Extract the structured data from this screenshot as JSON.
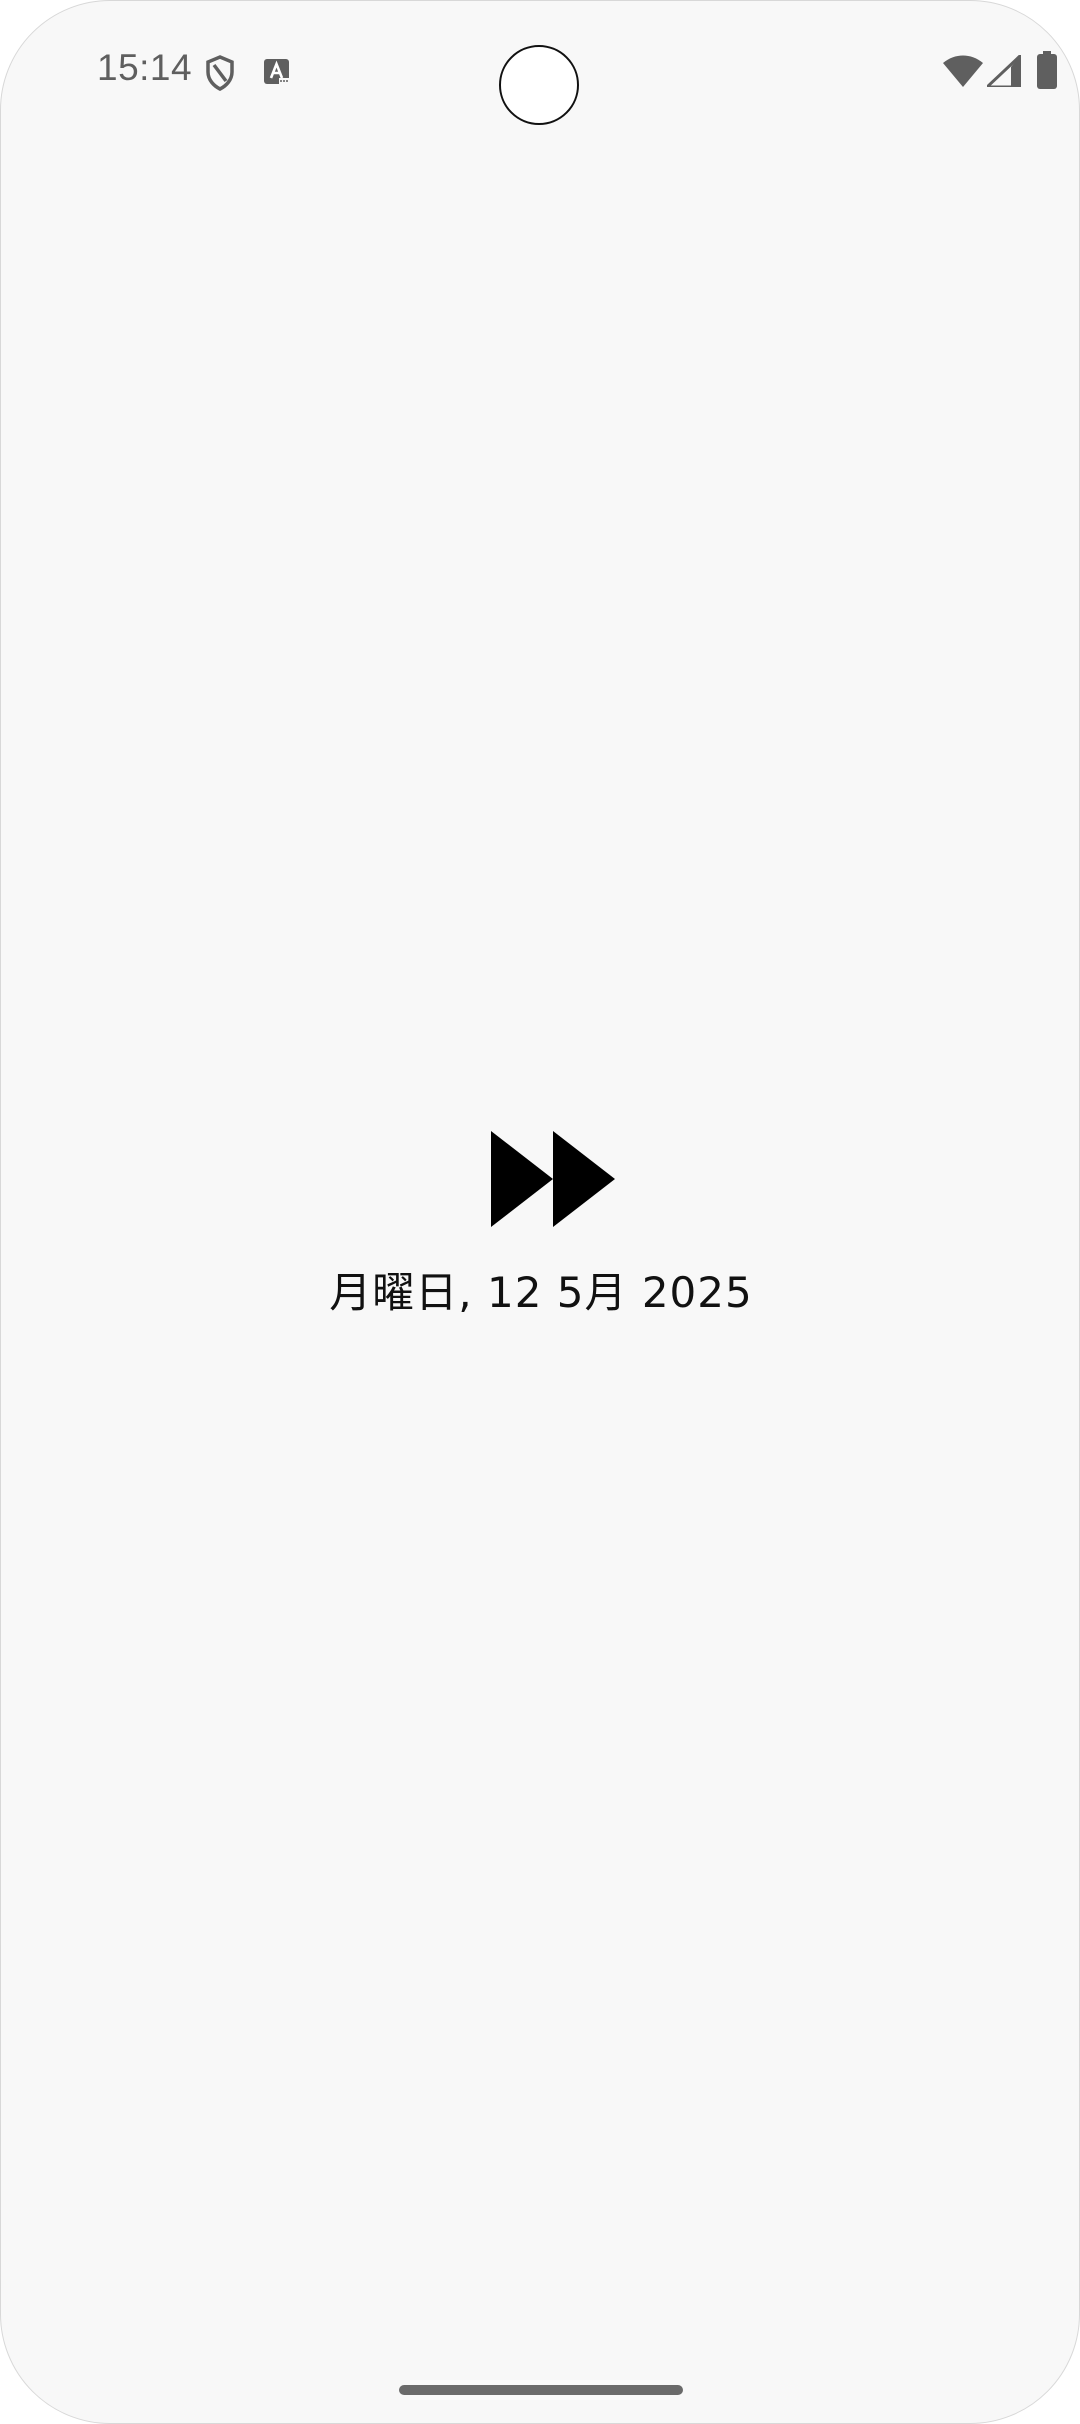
{
  "status_bar": {
    "time": "15:14",
    "icons": [
      "shield-icon",
      "a-notification-icon",
      "wifi-icon",
      "signal-icon",
      "battery-icon"
    ]
  },
  "main": {
    "icon": "fast-forward-icon",
    "date_text": "月曜日, 12 5月 2025"
  },
  "colors": {
    "background": "#f8f8f8",
    "status_icons": "#5f5f5f",
    "text": "#111111"
  }
}
